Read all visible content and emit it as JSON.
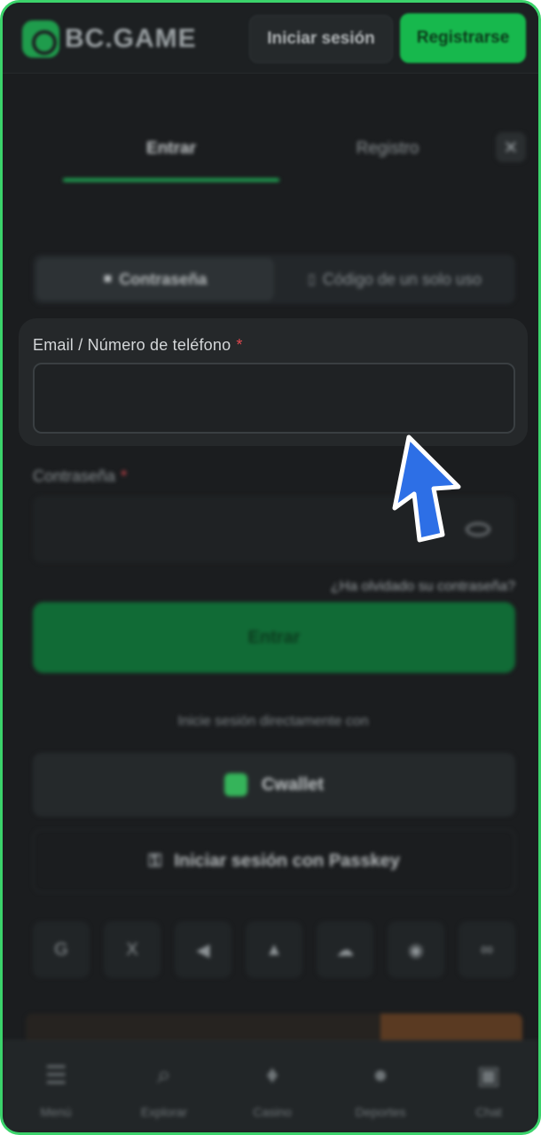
{
  "header": {
    "logo_text": "BC.GAME",
    "login_label": "Iniciar sesión",
    "register_label": "Registrarse"
  },
  "tabs": {
    "enter_label": "Entrar",
    "register_label": "Registro",
    "close_glyph": "✕"
  },
  "method": {
    "password_label": "Contraseña",
    "otp_label": "Código de un solo uso"
  },
  "form": {
    "email_label": "Email / Número de teléfono",
    "required_mark": "*",
    "email_value": "",
    "password_label": "Contraseña",
    "forgot_label": "¿Ha olvidado su contraseña?",
    "submit_label": "Entrar"
  },
  "alt_login": {
    "direct_label": "Inicie sesión directamente con",
    "cwallet_label": "Cwallet",
    "passkey_label": "Iniciar sesión con Passkey",
    "socials": [
      {
        "name": "google-icon",
        "glyph": "G"
      },
      {
        "name": "x-icon",
        "glyph": "X"
      },
      {
        "name": "telegram-icon",
        "glyph": "◀"
      },
      {
        "name": "metamask-icon",
        "glyph": "▲"
      },
      {
        "name": "cloud-icon",
        "glyph": "☁"
      },
      {
        "name": "whatsapp-icon",
        "glyph": "◉"
      },
      {
        "name": "link-icon",
        "glyph": "∞"
      }
    ]
  },
  "bottom_nav": [
    {
      "label": "Menú",
      "icon": "☰"
    },
    {
      "label": "Explorar",
      "icon": "⌕"
    },
    {
      "label": "Casino",
      "icon": "♦"
    },
    {
      "label": "Deportes",
      "icon": "●"
    },
    {
      "label": "Chat",
      "icon": "▣"
    }
  ],
  "colors": {
    "accent": "#17b84d",
    "frame": "#3bd36b",
    "background": "#1b1d1f",
    "pointer": "#2d6fe6"
  }
}
